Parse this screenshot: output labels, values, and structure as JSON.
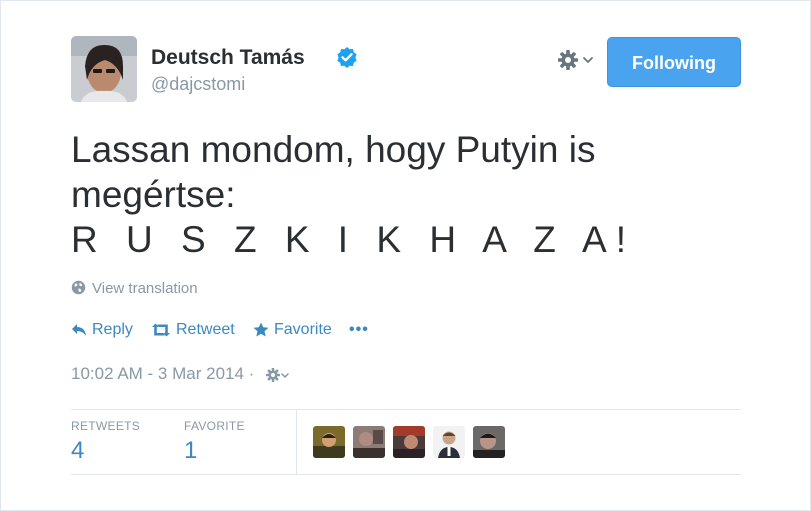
{
  "user": {
    "name": "Deutsch Tamás",
    "handle": "@dajcstomi",
    "verified": true,
    "avatar": "user-avatar"
  },
  "header": {
    "gear_icon": "gear-icon",
    "follow_label": "Following",
    "follow_color": "#4aa3ee"
  },
  "tweet": {
    "lines": [
      "Lassan mondom, hogy Putyin is",
      "megértse:",
      "R U S Z K I K  H A Z A!"
    ]
  },
  "translation": {
    "label": "View translation",
    "icon": "globe-icon"
  },
  "actions": {
    "reply": "Reply",
    "retweet": "Retweet",
    "favorite": "Favorite",
    "more": "•••",
    "color": "#3b88c3"
  },
  "timestamp": {
    "text": "10:02 AM - 3 Mar 2014 ·"
  },
  "stats": {
    "retweets_label": "RETWEETS",
    "retweets_value": "4",
    "favorites_label": "FAVORITE",
    "favorites_value": "1"
  },
  "favoriters": [
    "favoriter-avatar-1",
    "favoriter-avatar-2",
    "favoriter-avatar-3",
    "favoriter-avatar-4",
    "favoriter-avatar-5"
  ]
}
